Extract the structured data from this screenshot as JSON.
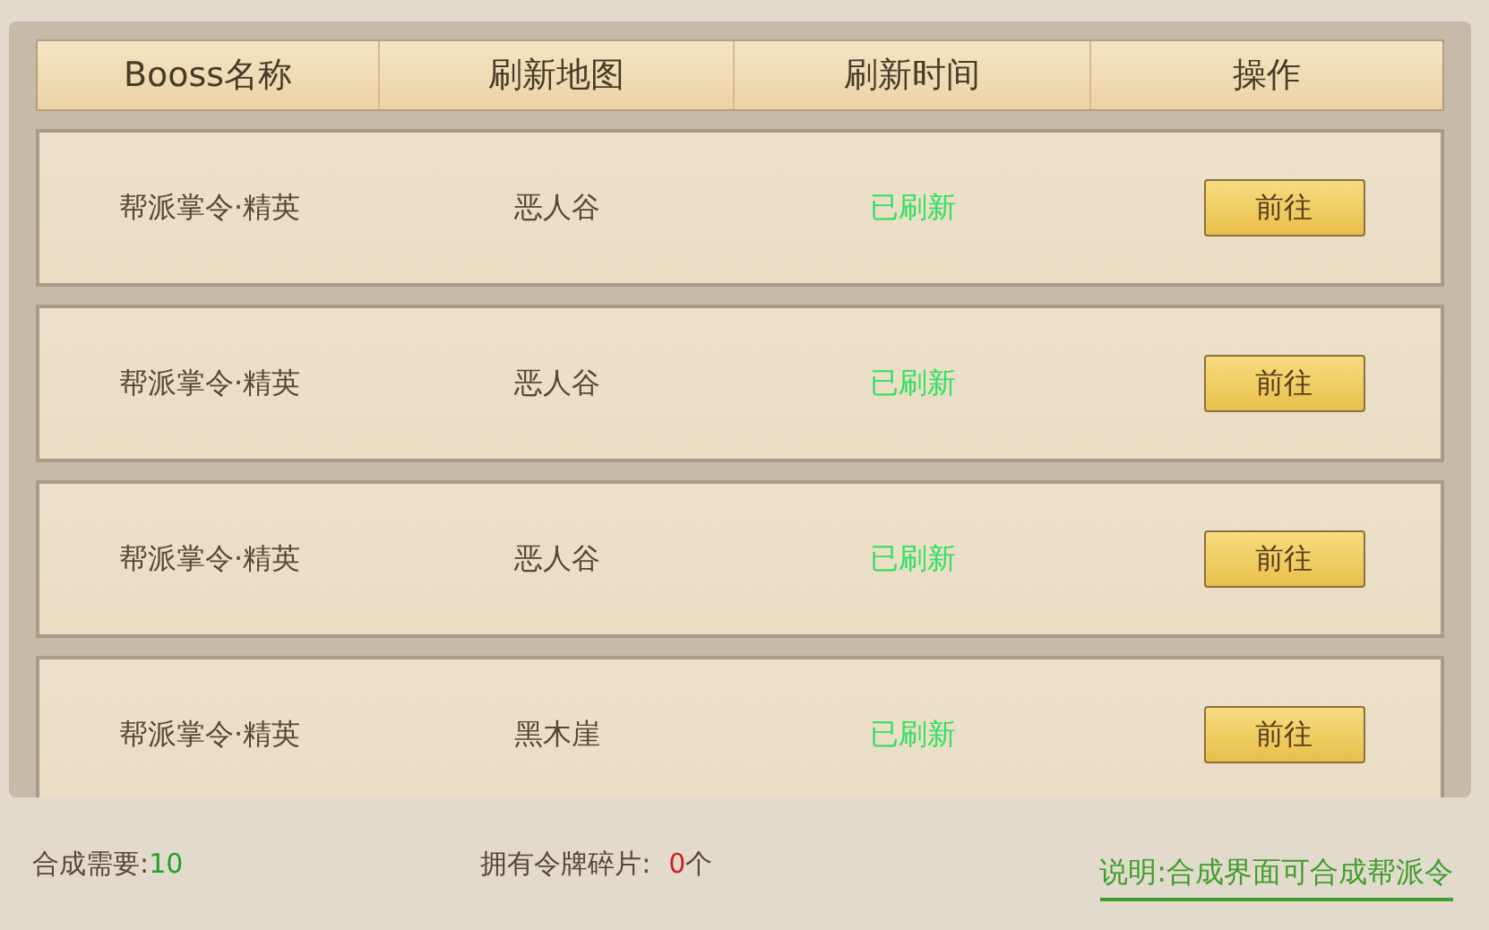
{
  "table": {
    "columns": [
      "Booss名称",
      "刷新地图",
      "刷新时间",
      "操作"
    ],
    "rows": [
      {
        "name": "帮派掌令·精英",
        "map": "恶人谷",
        "status": "已刷新",
        "action": "前往"
      },
      {
        "name": "帮派掌令·精英",
        "map": "恶人谷",
        "status": "已刷新",
        "action": "前往"
      },
      {
        "name": "帮派掌令·精英",
        "map": "恶人谷",
        "status": "已刷新",
        "action": "前往"
      },
      {
        "name": "帮派掌令·精英",
        "map": "黑木崖",
        "status": "已刷新",
        "action": "前往"
      }
    ]
  },
  "footer": {
    "required_label": "合成需要:",
    "required_value": "10",
    "owned_label": "拥有令牌碎片:",
    "owned_value": "0",
    "owned_unit": "个",
    "note": "说明:合成界面可合成帮派令"
  }
}
